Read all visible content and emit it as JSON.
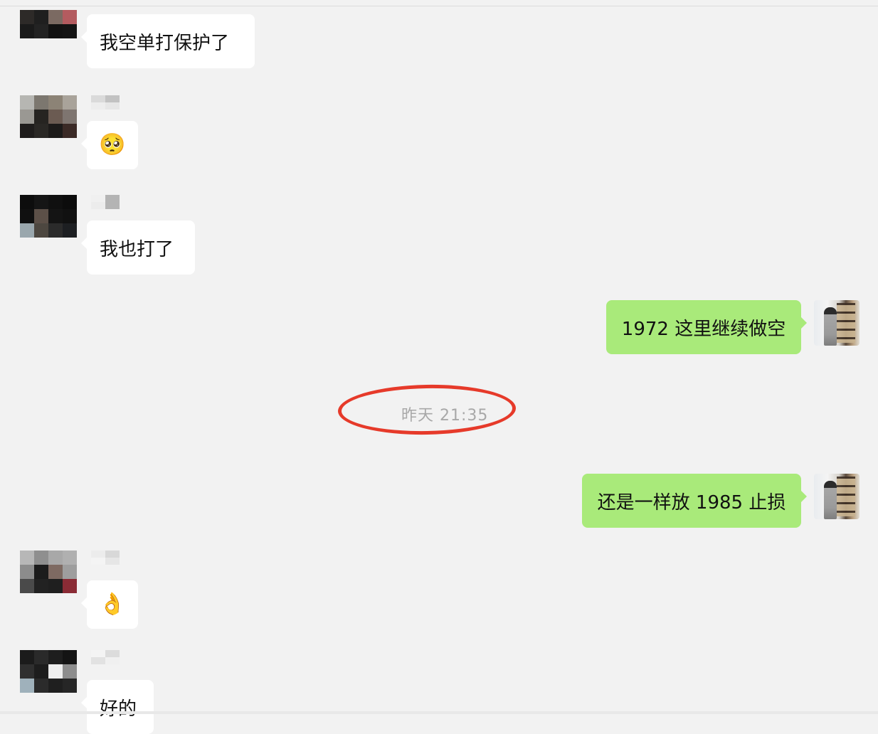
{
  "chat": {
    "messages": [
      {
        "side": "left",
        "type": "text",
        "text": "我空单打保护了"
      },
      {
        "side": "left",
        "type": "emoji",
        "emoji": "🥺"
      },
      {
        "side": "left",
        "type": "text",
        "text": "我也打了"
      },
      {
        "side": "right",
        "type": "text",
        "text": "1972 这里继续做空"
      },
      {
        "side": "right",
        "type": "text",
        "text": "还是一样放 1985 止损"
      },
      {
        "side": "left",
        "type": "emoji",
        "emoji": "👌"
      },
      {
        "side": "left",
        "type": "text",
        "text": "好的"
      }
    ],
    "timestamp": "昨天 21:35",
    "annotation_color": "#e63a2a",
    "bubble_colors": {
      "incoming": "#ffffff",
      "outgoing": "#a9ea7a"
    }
  }
}
